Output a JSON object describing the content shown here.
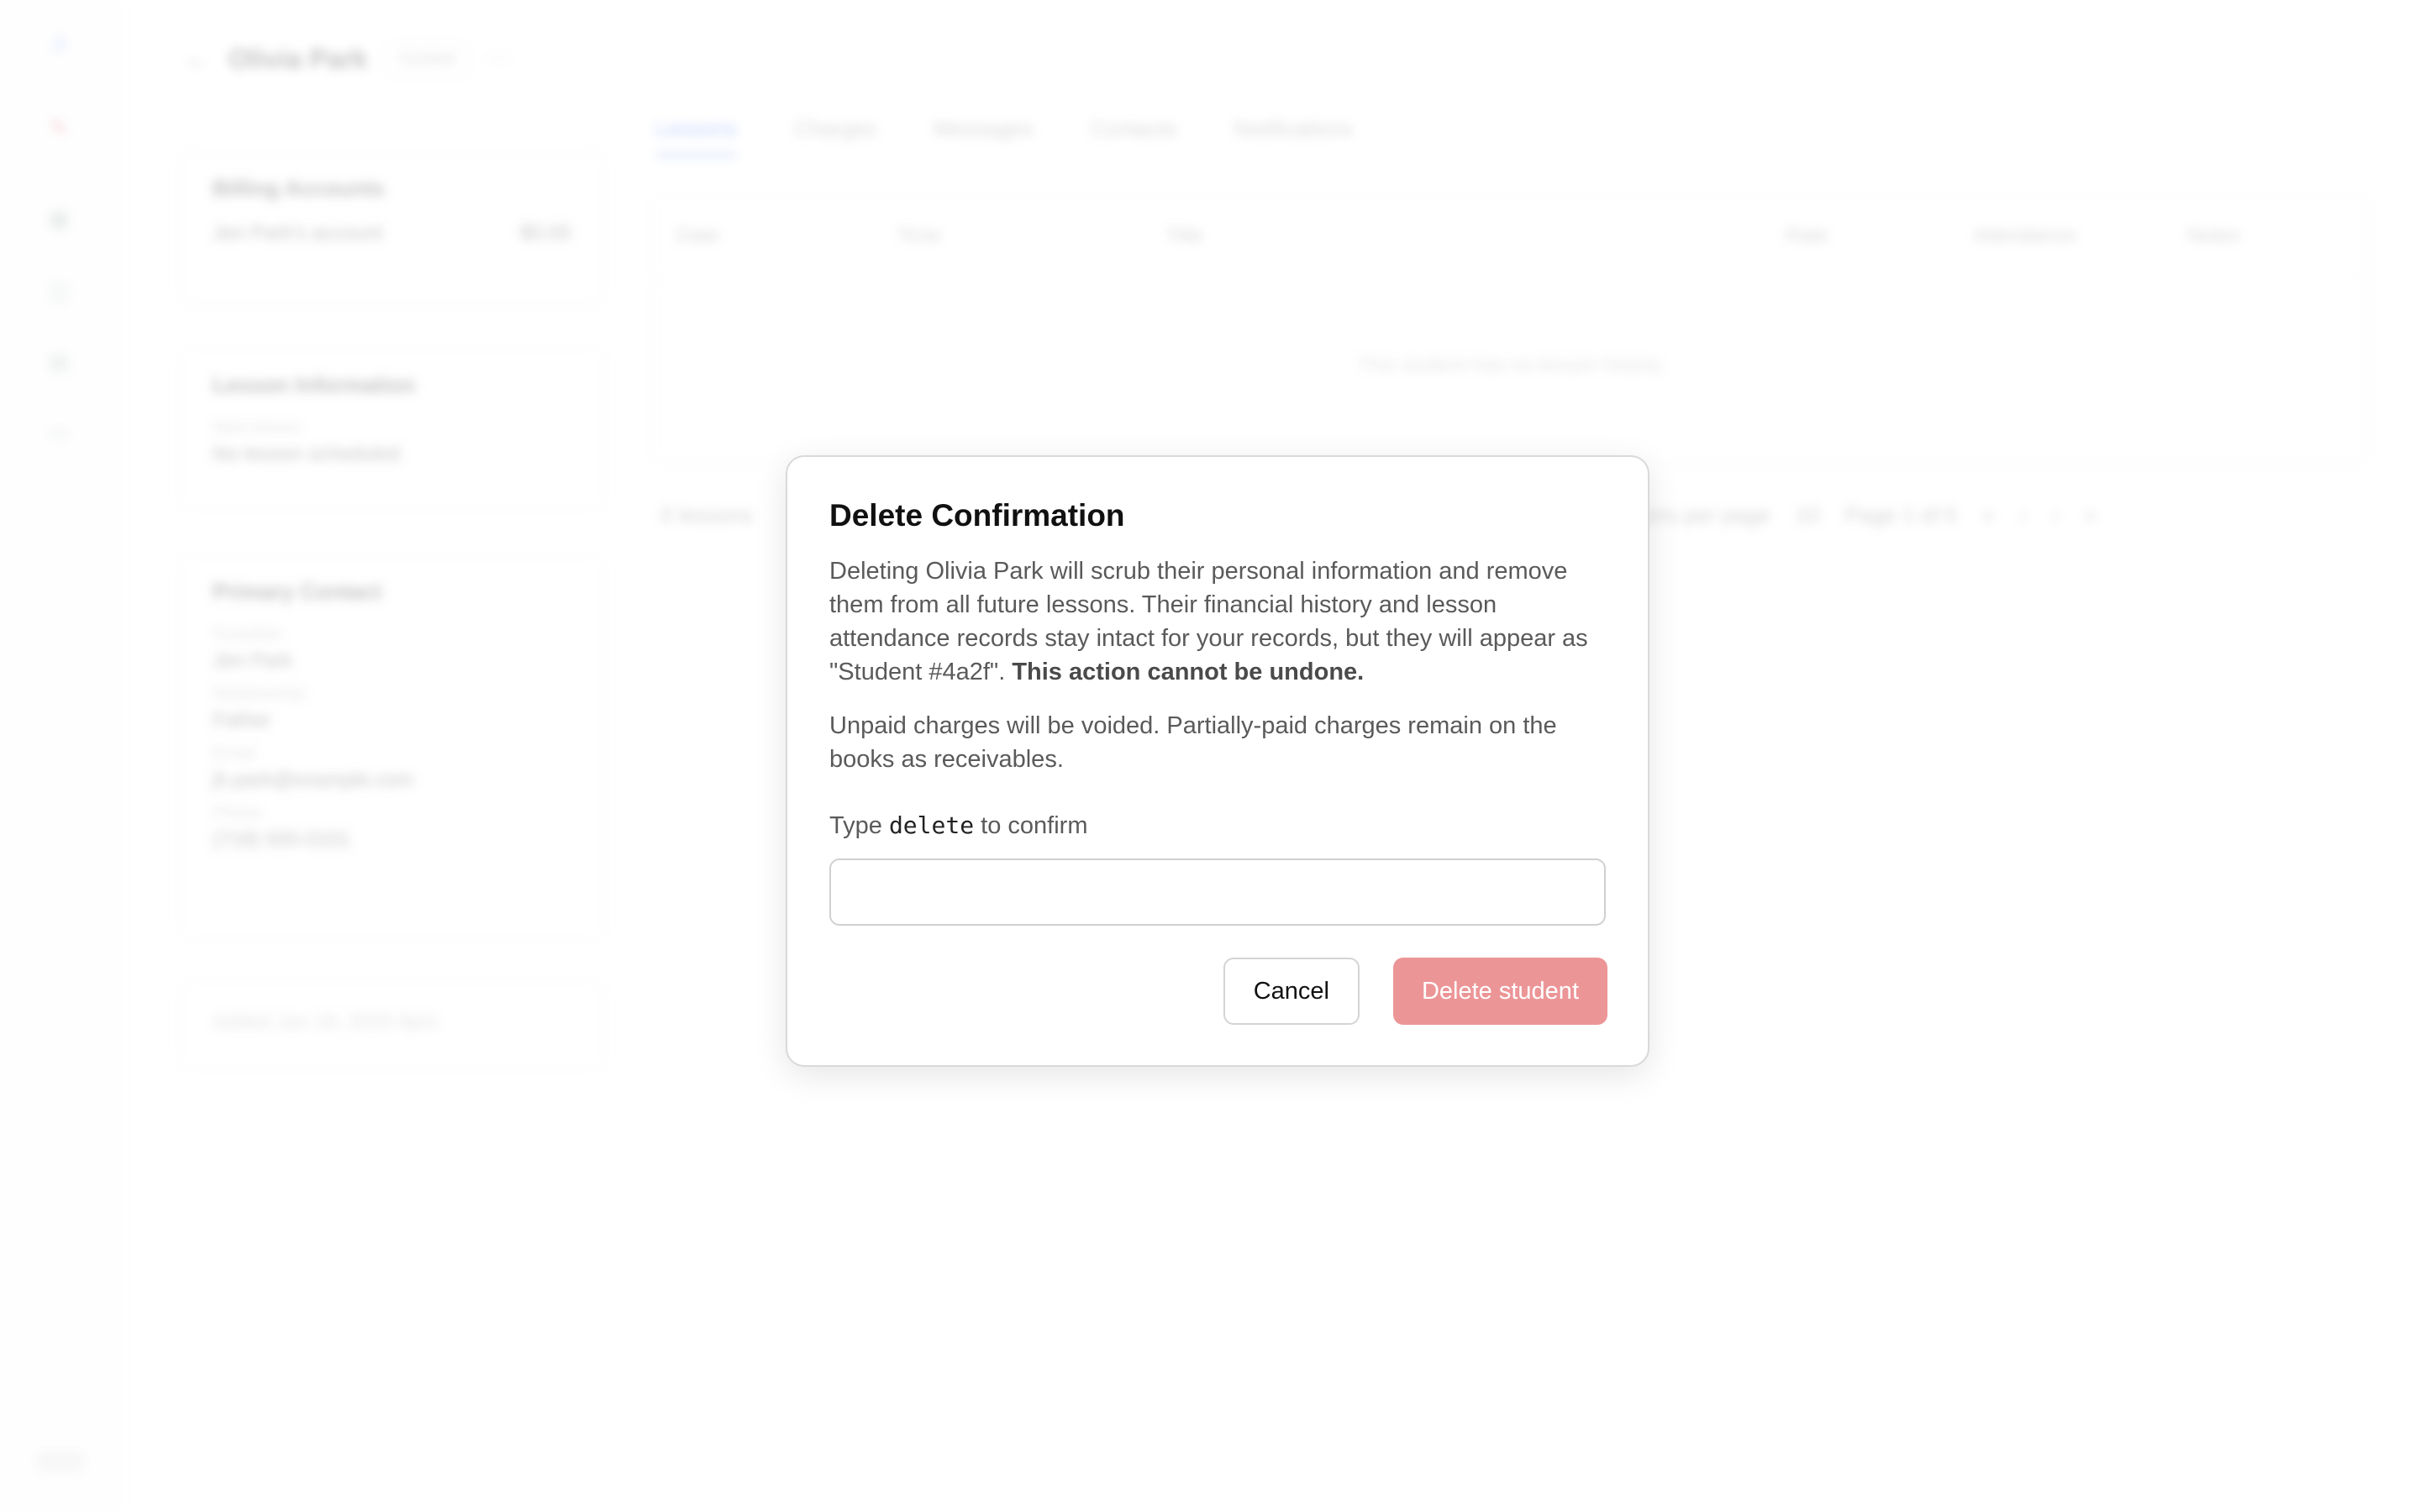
{
  "student": {
    "name": "Olivia Park",
    "status": "Current"
  },
  "billing": {
    "title": "Billing Accounts",
    "account": "Jen Park's account",
    "balance": "$0.00"
  },
  "lesson_info": {
    "title": "Lesson Information",
    "next_label": "Next lesson",
    "next_value": "No lesson scheduled"
  },
  "contact": {
    "title": "Primary Contact",
    "fields": [
      {
        "label": "Guardian",
        "value": "Jen Park"
      },
      {
        "label": "Relationship",
        "value": "Father"
      },
      {
        "label": "Email",
        "value": "jh.park@example.com"
      },
      {
        "label": "Phone",
        "value": "(718) 555-0101"
      }
    ]
  },
  "meta": {
    "created": "Added Jan 18, 2025 8pm"
  },
  "tabs": [
    "Lessons",
    "Charges",
    "Messages",
    "Contacts",
    "Notifications"
  ],
  "table": {
    "columns": [
      "Date",
      "Time",
      "Title",
      "Rate",
      "Attendance",
      "Notes"
    ],
    "empty": "This student has no lesson history"
  },
  "pager": {
    "count": "0 lessons",
    "per_page_label": "Lessons per page",
    "per_page": "10",
    "page": "Page 1 of 0"
  },
  "dialog": {
    "title": "Delete Confirmation",
    "body_main": "Deleting Olivia Park will scrub their personal information and remove them from all future lessons. Their financial history and lesson attendance records stay intact for your records, but they will appear as \"Student #4a2f\". ",
    "body_strong": "This action cannot be undone.",
    "body_secondary": "Unpaid charges will be voided. Partially-paid charges remain on the books as receivables.",
    "confirm_prefix": "Type",
    "confirm_word": "delete",
    "confirm_suffix": "to confirm",
    "input_value": "",
    "cancel_label": "Cancel",
    "delete_label": "Delete student"
  },
  "colors": {
    "accent": "#3b6ef5",
    "danger_disabled": "#ec9597"
  }
}
